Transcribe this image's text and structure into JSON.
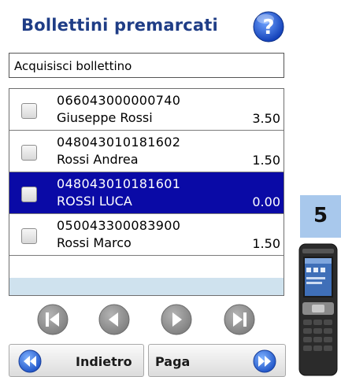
{
  "header": {
    "title": "Bollettini premarcati",
    "help_icon": "help-question-icon"
  },
  "action": {
    "label": "Acquisisci bollettino"
  },
  "bollettini": [
    {
      "code": "066043000000740",
      "name": "Giuseppe Rossi",
      "amount": "3.50",
      "selected": false
    },
    {
      "code": "048043010181602",
      "name": "Rossi Andrea",
      "amount": "1.50",
      "selected": false
    },
    {
      "code": "048043010181601",
      "name": "ROSSI LUCA",
      "amount": "0.00",
      "selected": true
    },
    {
      "code": "050043300083900",
      "name": "Rossi Marco",
      "amount": "1.50",
      "selected": false
    }
  ],
  "navigation": {
    "icons": [
      "first-page-icon",
      "previous-page-icon",
      "next-page-icon",
      "last-page-icon"
    ]
  },
  "footer": {
    "back_label": "Indietro",
    "pay_label": "Paga",
    "back_icon": "double-arrow-left-icon",
    "forward_icon": "double-arrow-right-icon"
  },
  "step": {
    "number": "5"
  },
  "colors": {
    "title": "#1f3d86",
    "selection": "#0a0aa6",
    "empty_row": "#cfe2ee",
    "nav_button": "#8f8f8f",
    "step_badge": "#a8c8ec"
  }
}
